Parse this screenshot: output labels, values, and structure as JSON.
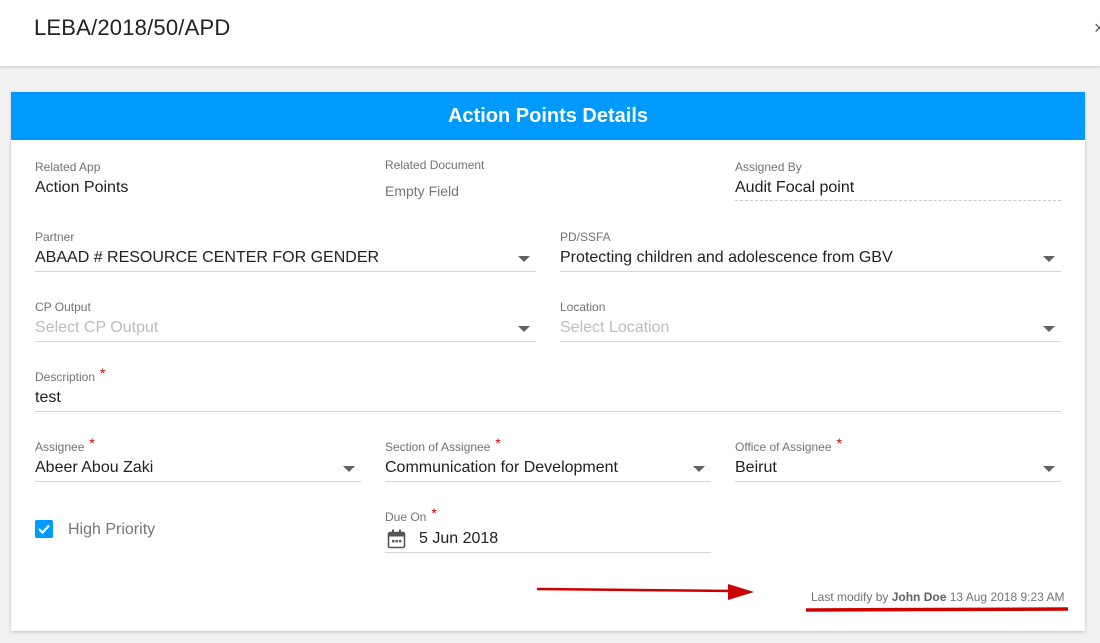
{
  "header": {
    "title": "LEBA/2018/50/APD",
    "close_glyph": "×"
  },
  "card": {
    "title": "Action Points Details",
    "accent_color": "#0099ff",
    "fields": {
      "related_app": {
        "label": "Related App",
        "value": "Action Points"
      },
      "related_document": {
        "label": "Related Document",
        "value": "Empty Field"
      },
      "assigned_by": {
        "label": "Assigned By",
        "value": "Audit Focal point"
      },
      "partner": {
        "label": "Partner",
        "value": "ABAAD # RESOURCE CENTER FOR GENDER"
      },
      "pd_ssfa": {
        "label": "PD/SSFA",
        "value": "Protecting children and adolescence from GBV"
      },
      "cp_output": {
        "label": "CP Output",
        "placeholder": "Select CP Output"
      },
      "location": {
        "label": "Location",
        "placeholder": "Select Location"
      },
      "description": {
        "label": "Description",
        "required": "*",
        "value": "test"
      },
      "assignee": {
        "label": "Assignee",
        "required": "*",
        "value": "Abeer Abou Zaki"
      },
      "section_of_assignee": {
        "label": "Section of Assignee",
        "required": "*",
        "value": "Communication for Development"
      },
      "office_of_assignee": {
        "label": "Office of Assignee",
        "required": "*",
        "value": "Beirut"
      },
      "high_priority": {
        "label": "High Priority",
        "checked": true
      },
      "due_on": {
        "label": "Due On",
        "required": "*",
        "value": "5 Jun 2018",
        "icon": "calendar-icon"
      }
    },
    "last_modified": {
      "prefix": "Last modify by",
      "user": "John Doe",
      "timestamp": "13 Aug 2018 9:23 AM"
    }
  },
  "annotation": {
    "color": "#cc0000"
  }
}
